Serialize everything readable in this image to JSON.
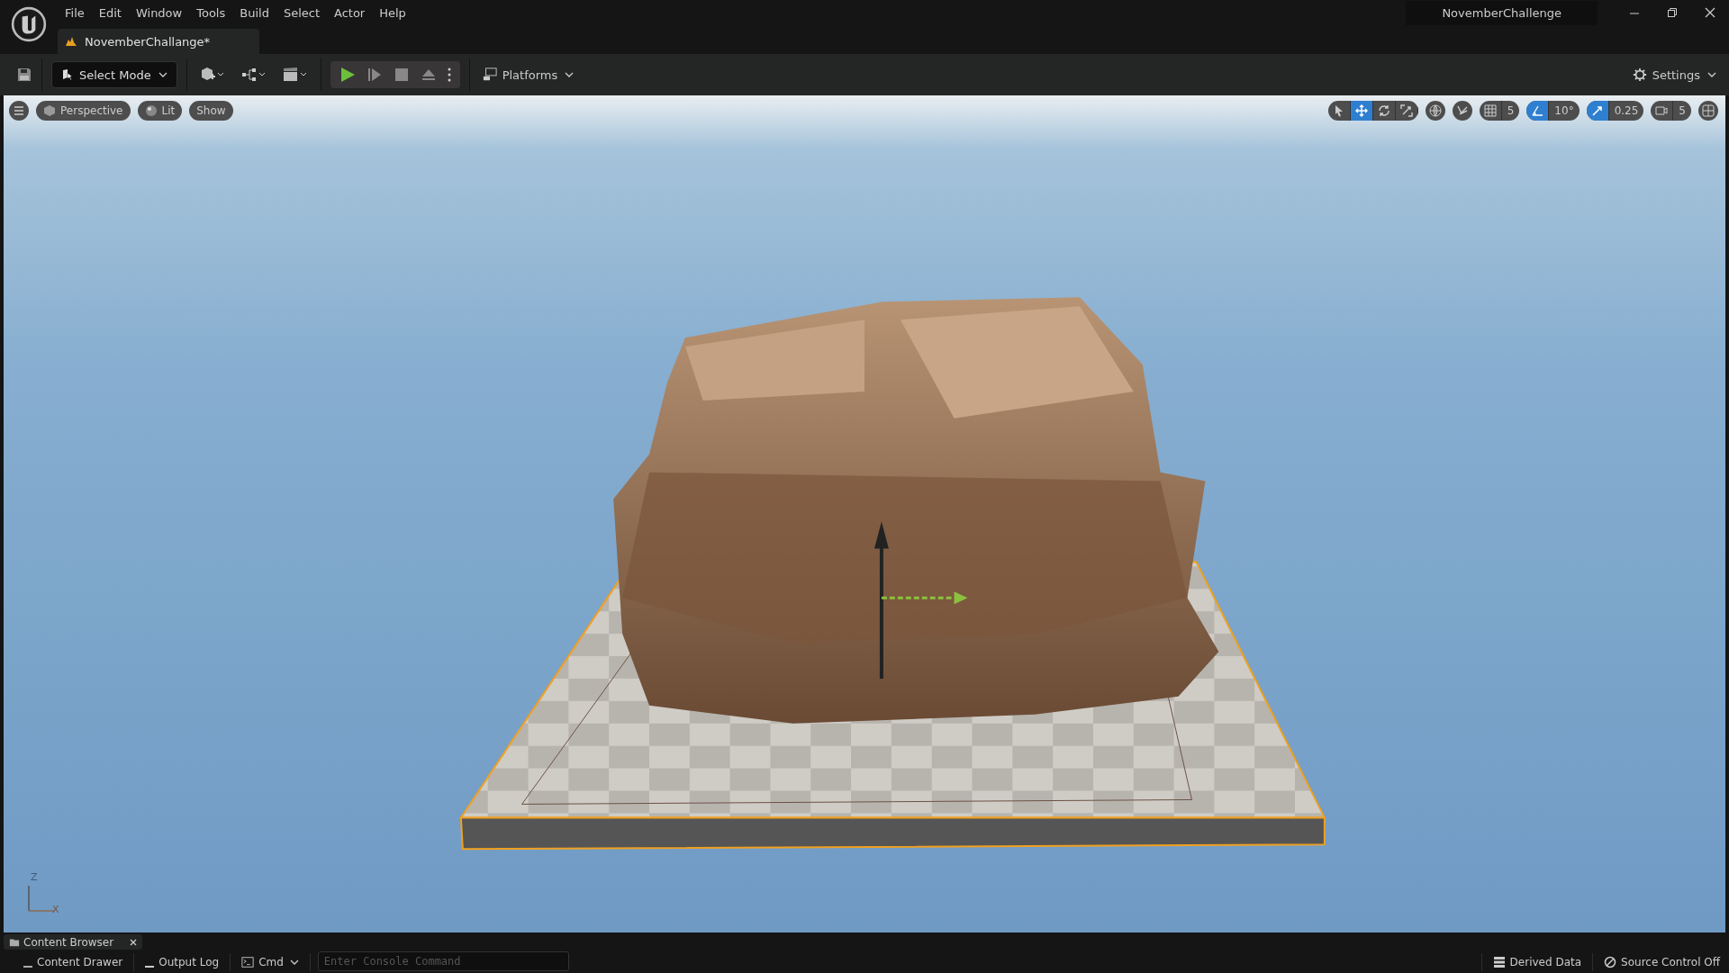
{
  "menu": [
    "File",
    "Edit",
    "Window",
    "Tools",
    "Build",
    "Select",
    "Actor",
    "Help"
  ],
  "document_tab": {
    "label": "NovemberChallange*"
  },
  "project_name": "NovemberChallenge",
  "toolbar": {
    "select_mode": "Select Mode",
    "platforms": "Platforms",
    "settings": "Settings"
  },
  "viewport": {
    "view_buttons": [
      {
        "kind": "menu"
      },
      {
        "kind": "perspective",
        "label": "Perspective"
      },
      {
        "kind": "lit",
        "label": "Lit"
      },
      {
        "kind": "show",
        "label": "Show"
      }
    ],
    "transform_tools": [
      {
        "kind": "select",
        "selected": false
      },
      {
        "kind": "move",
        "selected": true
      },
      {
        "kind": "rotate",
        "selected": false
      },
      {
        "kind": "scale",
        "selected": false
      }
    ],
    "snaps": [
      {
        "kind": "grid",
        "value": "5",
        "on": false
      },
      {
        "kind": "angle",
        "value": "10°",
        "on": true
      },
      {
        "kind": "scale",
        "value": "0.25",
        "on": true
      },
      {
        "kind": "camera",
        "value": "5",
        "on": false
      }
    ],
    "axis": {
      "up": "Z",
      "right": "X"
    }
  },
  "status_bar": {
    "content_browser_tab": "Content Browser",
    "items": [
      {
        "kind": "drawer",
        "label": "Content Drawer"
      },
      {
        "kind": "log",
        "label": "Output Log"
      },
      {
        "kind": "cmd",
        "label": "Cmd"
      }
    ],
    "console": {
      "placeholder": "Enter Console Command"
    },
    "right_items": [
      {
        "kind": "ddc",
        "label": "Derived Data"
      },
      {
        "kind": "scc",
        "label": "Source Control Off"
      }
    ]
  }
}
